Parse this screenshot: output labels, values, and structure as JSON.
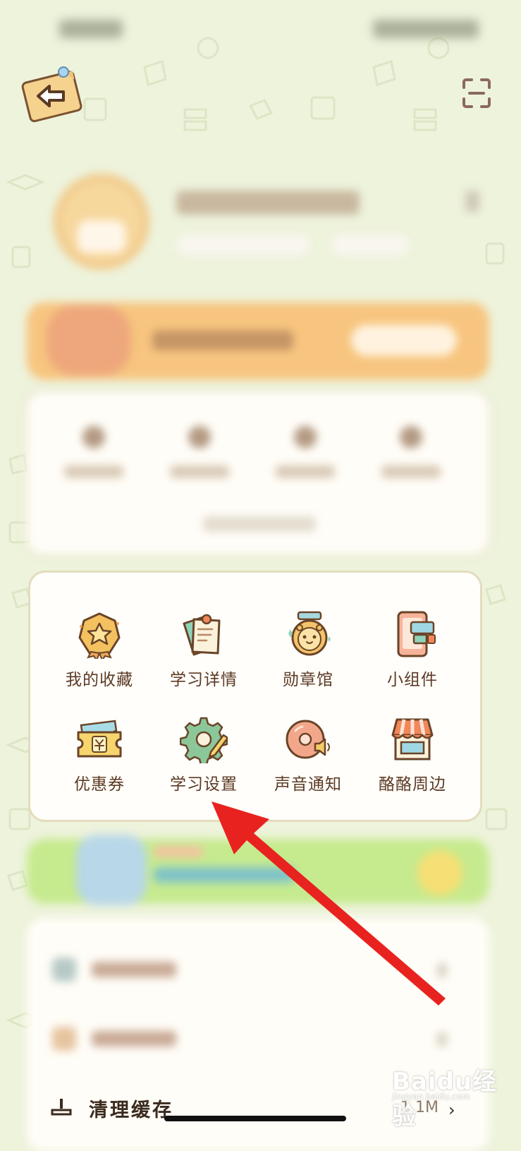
{
  "header": {
    "back_icon": "back-arrow-sticky-note-icon",
    "scan_icon": "scan-icon"
  },
  "feature_grid": {
    "items": [
      {
        "label": "我的收藏",
        "icon": "star-badge-icon"
      },
      {
        "label": "学习详情",
        "icon": "memo-note-icon"
      },
      {
        "label": "勋章馆",
        "icon": "medal-hamster-icon"
      },
      {
        "label": "小组件",
        "icon": "widget-tablet-icon"
      },
      {
        "label": "优惠券",
        "icon": "coupon-ticket-icon"
      },
      {
        "label": "学习设置",
        "icon": "gear-pencil-icon"
      },
      {
        "label": "声音通知",
        "icon": "speaker-disc-icon"
      },
      {
        "label": "酪酪周边",
        "icon": "shop-awning-icon"
      }
    ]
  },
  "cache": {
    "label": "清理缓存",
    "size": "1.1M",
    "chevron": "›"
  },
  "watermark": {
    "text": "Baidu经验",
    "sub": "jingyan.baidu.com"
  },
  "colors": {
    "background": "#eef3dc",
    "card": "#fffefa",
    "label": "#5c3a24",
    "annotation_arrow": "#e8231f"
  }
}
